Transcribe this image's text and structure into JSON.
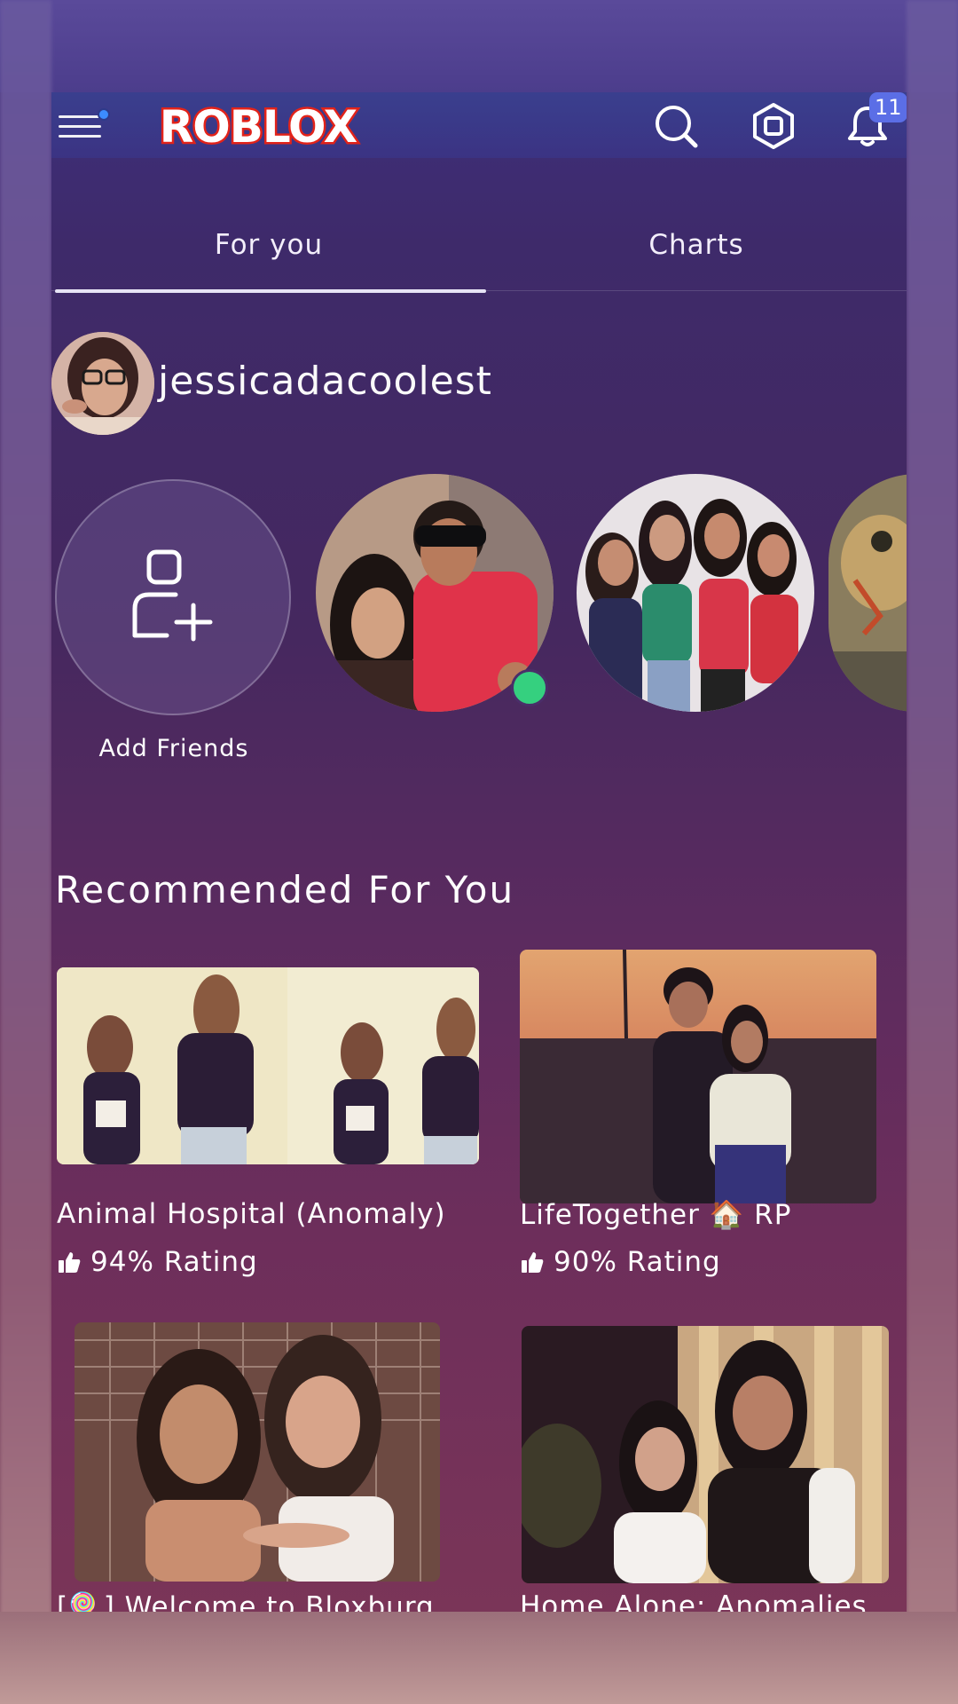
{
  "header": {
    "logo_text": "ROBLOX",
    "notification_count": "11"
  },
  "tabs": [
    {
      "label": "For you",
      "active": true
    },
    {
      "label": "Charts",
      "active": false
    }
  ],
  "user": {
    "username": "jessicadacoolest"
  },
  "friends": {
    "add_label": "Add Friends",
    "items": [
      {
        "online": true
      },
      {
        "online": false
      },
      {
        "online": false
      }
    ]
  },
  "recommended": {
    "title": "Recommended For You",
    "games": [
      {
        "title": "Animal Hospital (Anomaly)",
        "rating": "94% Rating"
      },
      {
        "title": "LifeTogether 🏠 RP",
        "rating": "90% Rating"
      },
      {
        "title": "[🍭] Welcome to Bloxburg",
        "rating": ""
      },
      {
        "title": "Home Alone: Anomalies",
        "rating": ""
      }
    ]
  },
  "colors": {
    "accent": "#5b6ee6",
    "online": "#35d07f",
    "logo": "#e2231a"
  }
}
